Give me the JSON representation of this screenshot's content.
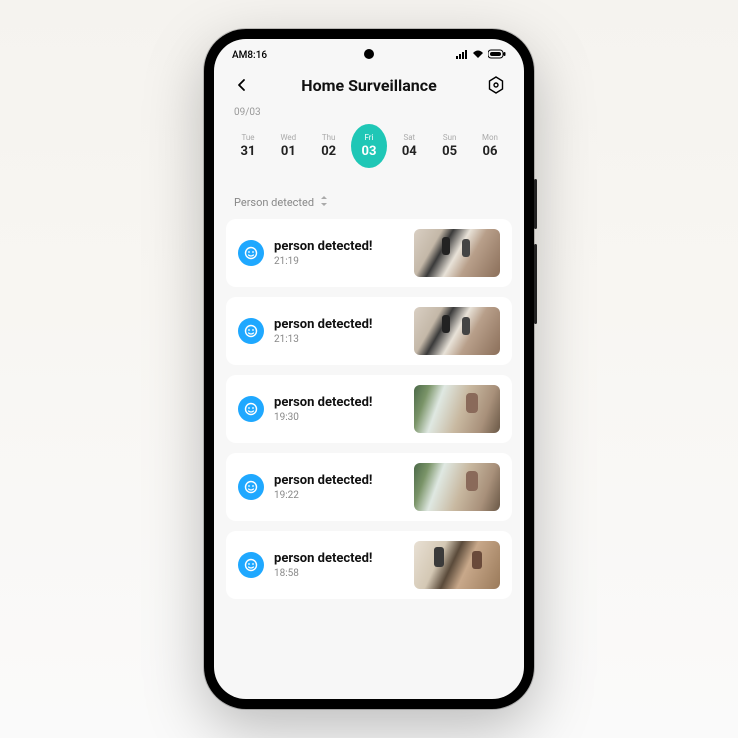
{
  "status_bar": {
    "time": "AM8:16"
  },
  "header": {
    "title": "Home  Surveillance"
  },
  "date_label": "09/03",
  "calendar": {
    "days": [
      {
        "dow": "Tue",
        "num": "31",
        "active": false
      },
      {
        "dow": "Wed",
        "num": "01",
        "active": false
      },
      {
        "dow": "Thu",
        "num": "02",
        "active": false
      },
      {
        "dow": "Fri",
        "num": "03",
        "active": true
      },
      {
        "dow": "Sat",
        "num": "04",
        "active": false
      },
      {
        "dow": "Sun",
        "num": "05",
        "active": false
      },
      {
        "dow": "Mon",
        "num": "06",
        "active": false
      }
    ]
  },
  "filter": {
    "label": "Person detected"
  },
  "events": [
    {
      "title": "person detected!",
      "time": "21:19",
      "thumb": "a"
    },
    {
      "title": "person detected!",
      "time": "21:13",
      "thumb": "a"
    },
    {
      "title": "person detected!",
      "time": "19:30",
      "thumb": "b"
    },
    {
      "title": "person detected!",
      "time": "19:22",
      "thumb": "b"
    },
    {
      "title": "person detected!",
      "time": "18:58",
      "thumb": "c"
    }
  ],
  "colors": {
    "accent": "#1fc7b6",
    "icon_blue": "#1fa8ff"
  }
}
